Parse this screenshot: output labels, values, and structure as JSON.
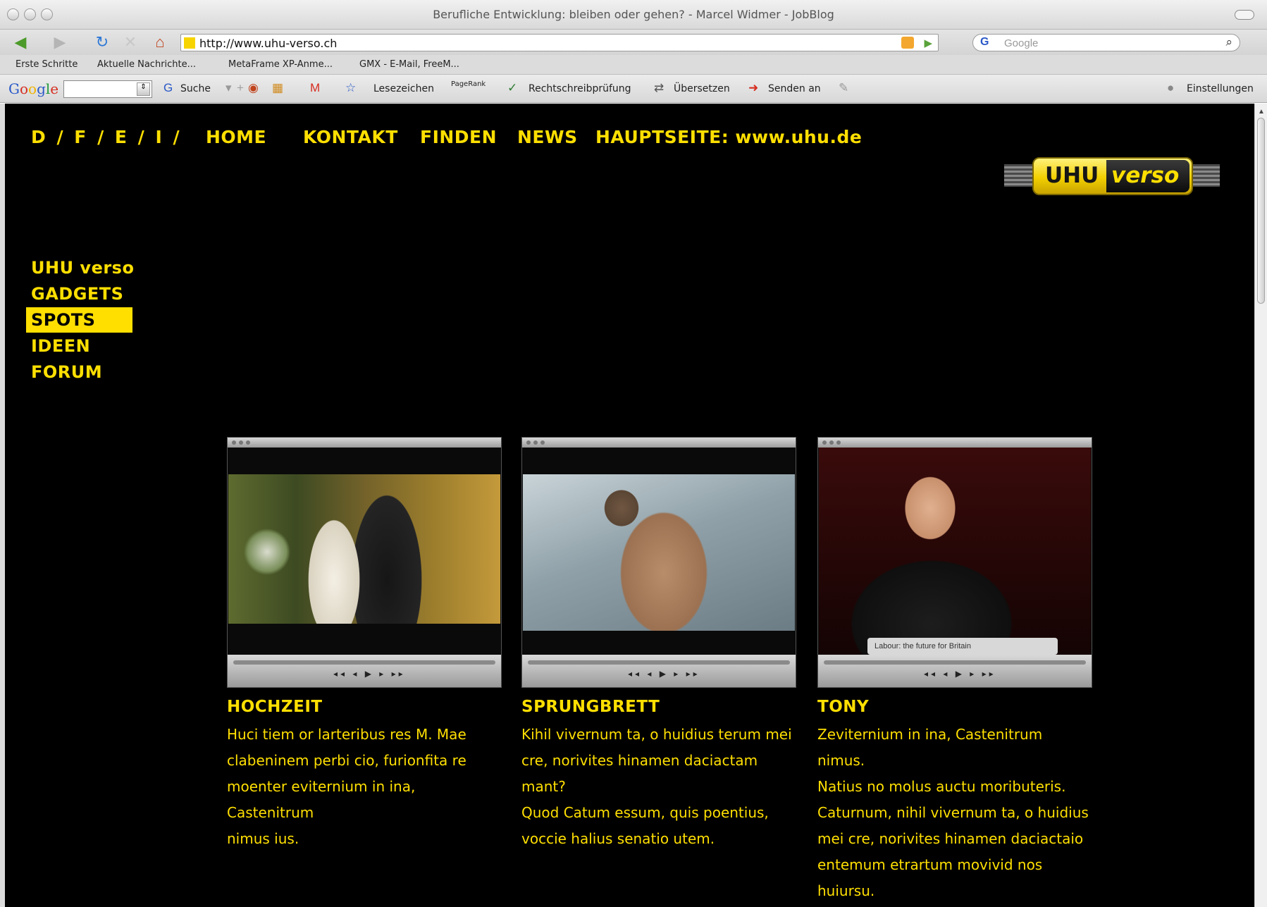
{
  "window": {
    "title": "Berufliche Entwicklung: bleiben oder gehen? - Marcel Widmer - JobBlog"
  },
  "address_bar": {
    "url": "http://www.uhu-verso.ch"
  },
  "search_bar": {
    "engine": "G",
    "placeholder": "Google"
  },
  "bookmarks": [
    "Erste Schritte",
    "Aktuelle Nachrichte...",
    "MetaFrame XP-Anme...",
    "GMX - E-Mail, FreeM..."
  ],
  "google_toolbar": {
    "logo": "Google",
    "search_label": "Suche",
    "bookmarks_label": "Lesezeichen",
    "pagerank_label": "PageRank",
    "spellcheck_label": "Rechtschreibprüfung",
    "translate_label": "Übersetzen",
    "send_label": "Senden an",
    "settings_label": "Einstellungen"
  },
  "site": {
    "languages": "D / F / E / I /",
    "top_nav": [
      "HOME",
      "KONTAKT",
      "FINDEN",
      "NEWS",
      "HAUPTSEITE: www.uhu.de"
    ],
    "logo": {
      "left": "UHU",
      "right": "verso"
    },
    "side_nav": [
      "UHU verso",
      "GADGETS",
      "SPOTS",
      "IDEEN",
      "FORUM"
    ],
    "active_side_nav": "SPOTS",
    "accent_color": "#ffdf00",
    "background_color": "#000000",
    "spots": [
      {
        "title": "HOCHZEIT",
        "lines": [
          "Huci tiem or larteribus res M. Mae",
          "clabeninem perbi cio, furionfita re",
          "moenter eviternium in ina, Castenitrum",
          "nimus ius."
        ]
      },
      {
        "title": "SPRUNGBRETT",
        "lines": [
          "Kihil vivernum ta, o huidius terum mei",
          "cre, norivites hinamen daciactam mant?",
          "Quod Catum essum, quis poentius,",
          "voccie halius senatio utem."
        ]
      },
      {
        "title": "TONY",
        "lines": [
          "Zeviternium in ina, Castenitrum nimus.",
          "Natius no molus auctu moributeris.",
          "Caturnum, nihil vivernum ta, o huidius",
          "mei cre, norivites hinamen daciactaio",
          "entemum etrartum movivid nos huiursu."
        ],
        "caption": "Labour: the future for Britain"
      }
    ]
  }
}
